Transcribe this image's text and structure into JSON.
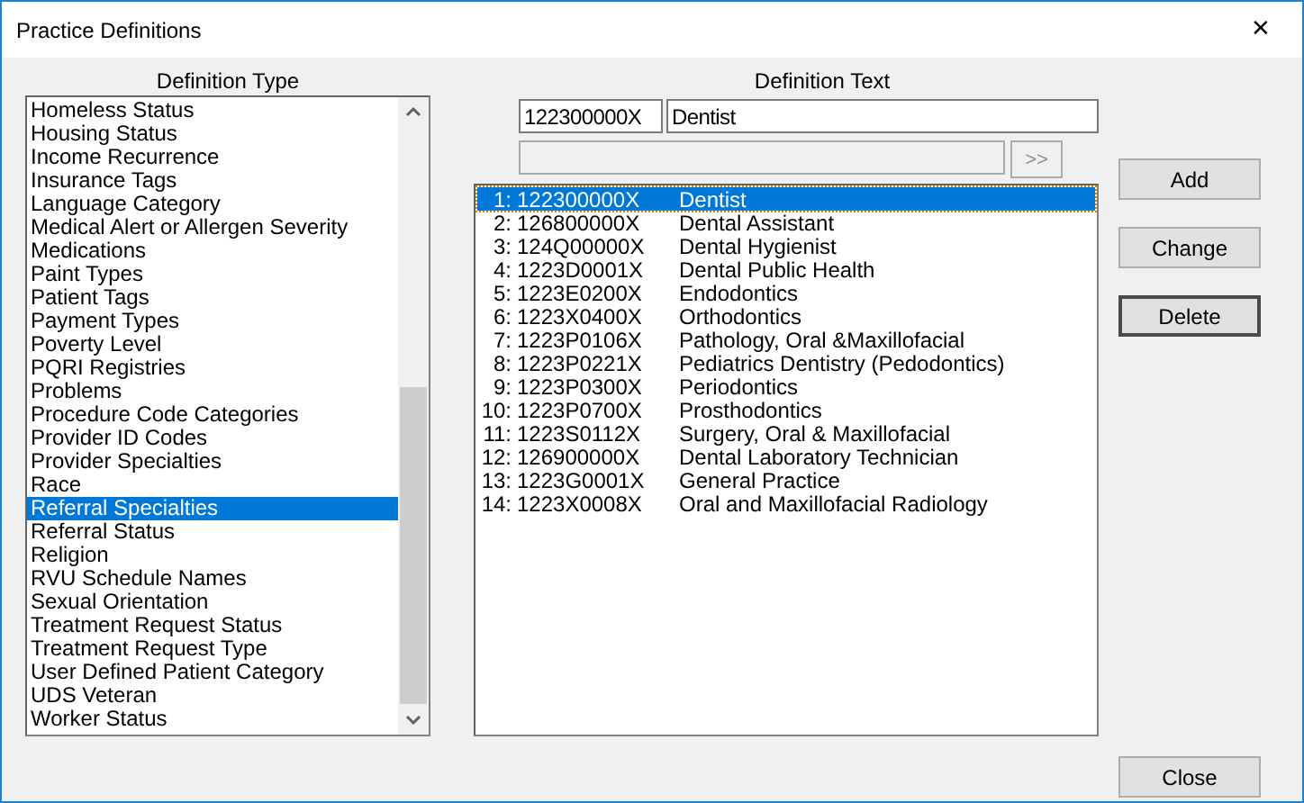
{
  "window": {
    "title": "Practice Definitions",
    "close": "✕"
  },
  "definition_type": {
    "label": "Definition Type",
    "items": [
      {
        "label": "Homeless Status",
        "selected": false
      },
      {
        "label": "Housing Status",
        "selected": false
      },
      {
        "label": "Income Recurrence",
        "selected": false
      },
      {
        "label": "Insurance Tags",
        "selected": false
      },
      {
        "label": "Language Category",
        "selected": false
      },
      {
        "label": "Medical Alert or Allergen Severity",
        "selected": false
      },
      {
        "label": "Medications",
        "selected": false
      },
      {
        "label": "Paint Types",
        "selected": false
      },
      {
        "label": "Patient Tags",
        "selected": false
      },
      {
        "label": "Payment Types",
        "selected": false
      },
      {
        "label": "Poverty Level",
        "selected": false
      },
      {
        "label": "PQRI Registries",
        "selected": false
      },
      {
        "label": "Problems",
        "selected": false
      },
      {
        "label": "Procedure Code Categories",
        "selected": false
      },
      {
        "label": "Provider ID Codes",
        "selected": false
      },
      {
        "label": "Provider Specialties",
        "selected": false
      },
      {
        "label": "Race",
        "selected": false
      },
      {
        "label": "Referral Specialties",
        "selected": true
      },
      {
        "label": "Referral Status",
        "selected": false
      },
      {
        "label": "Religion",
        "selected": false
      },
      {
        "label": "RVU Schedule Names",
        "selected": false
      },
      {
        "label": "Sexual Orientation",
        "selected": false
      },
      {
        "label": "Treatment Request Status",
        "selected": false
      },
      {
        "label": "Treatment Request Type",
        "selected": false
      },
      {
        "label": "User Defined Patient Category",
        "selected": false
      },
      {
        "label": "UDS Veteran",
        "selected": false
      },
      {
        "label": "Worker Status",
        "selected": false
      }
    ]
  },
  "definition_text": {
    "label": "Definition Text",
    "code": "122300000X",
    "name": "Dentist",
    "arrow_button": ">>",
    "items": [
      {
        "number": "1:",
        "code": "122300000X",
        "text": "Dentist",
        "selected": true
      },
      {
        "number": "2:",
        "code": "126800000X",
        "text": "Dental Assistant",
        "selected": false
      },
      {
        "number": "3:",
        "code": "124Q00000X",
        "text": "Dental Hygienist",
        "selected": false
      },
      {
        "number": "4:",
        "code": "1223D0001X",
        "text": "Dental Public Health",
        "selected": false
      },
      {
        "number": "5:",
        "code": "1223E0200X",
        "text": "Endodontics",
        "selected": false
      },
      {
        "number": "6:",
        "code": "1223X0400X",
        "text": "Orthodontics",
        "selected": false
      },
      {
        "number": "7:",
        "code": "1223P0106X",
        "text": "Pathology, Oral &Maxillofacial",
        "selected": false
      },
      {
        "number": "8:",
        "code": "1223P0221X",
        "text": "Pediatrics Dentistry (Pedodontics)",
        "selected": false
      },
      {
        "number": "9:",
        "code": "1223P0300X",
        "text": "Periodontics",
        "selected": false
      },
      {
        "number": "10:",
        "code": "1223P0700X",
        "text": "Prosthodontics",
        "selected": false
      },
      {
        "number": "11:",
        "code": "1223S0112X",
        "text": "Surgery, Oral & Maxillofacial",
        "selected": false
      },
      {
        "number": "12:",
        "code": "126900000X",
        "text": "Dental Laboratory Technician",
        "selected": false
      },
      {
        "number": "13:",
        "code": "1223G0001X",
        "text": "General Practice",
        "selected": false
      },
      {
        "number": "14:",
        "code": "1223X0008X",
        "text": "Oral and Maxillofacial Radiology",
        "selected": false
      }
    ]
  },
  "buttons": [
    {
      "label": "Add",
      "default": false
    },
    {
      "label": "Change",
      "default": false
    },
    {
      "label": "Delete",
      "default": true
    }
  ],
  "close_button": "Close"
}
